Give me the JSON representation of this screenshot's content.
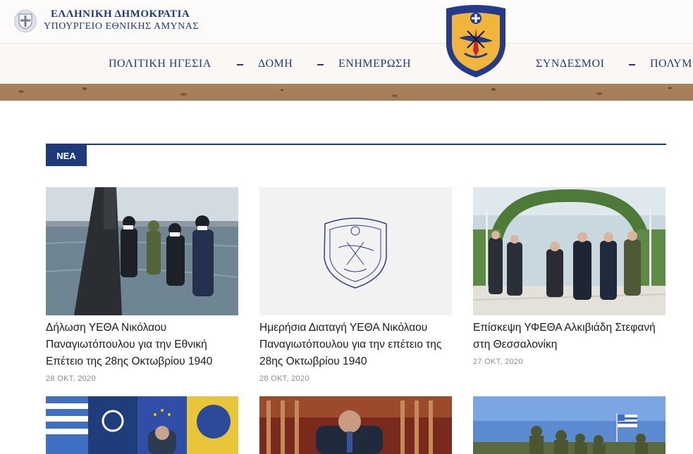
{
  "header": {
    "gov_title": "ΕΛΛΗΝΙΚΗ ΔΗΜΟΚΡΑΤΙΑ",
    "gov_subtitle": "ΥΠΟΥΡΓΕΙΟ ΕΘΝΙΚΗΣ ΑΜΥΝΑΣ",
    "emblem_icon": "greek-coat-of-arms-icon",
    "crest_icon": "ministry-crest-icon"
  },
  "nav": {
    "items": [
      {
        "label": "ΠΟΛΙΤΙΚΗ ΗΓΕΣΙΑ"
      },
      {
        "label": "ΔΟΜΗ"
      },
      {
        "label": "ΕΝΗΜΕΡΩΣΗ"
      },
      {
        "label": "ΣΥΝΔΕΣΜΟΙ"
      },
      {
        "label": "ΠΟΛΥΜ"
      }
    ]
  },
  "section": {
    "label": "ΝΕΑ"
  },
  "news": [
    {
      "title": "Δήλωση ΥΕΘΑ Νικόλαου Παναγιωτόπουλου για την Εθνική Επέτειο της 28ης Οκτωβρίου 1940",
      "date": "28 ΟΚΤ, 2020",
      "image": "officials-on-submarine-photo"
    },
    {
      "title": "Ημερήσια Διαταγή ΥΕΘΑ Νικόλαου Παναγιωτόπουλου για την επέτειο της 28ης Οκτωβρίου 1940",
      "date": "28 ΟΚΤ, 2020",
      "image": "ministry-crest-placeholder"
    },
    {
      "title": "Επίσκεψη ΥΦΕΘΑ Αλκιβιάδη Στεφανή στη Θεσσαλονίκη",
      "date": "27 ΟΚΤ, 2020",
      "image": "officials-walking-garden-photo"
    },
    {
      "image": "flags-meeting-photo"
    },
    {
      "image": "parliament-speech-photo"
    },
    {
      "image": "soldiers-with-flag-photo"
    }
  ],
  "colors": {
    "brand_blue": "#1f3a7a",
    "date_gray": "#8b8b8b"
  }
}
